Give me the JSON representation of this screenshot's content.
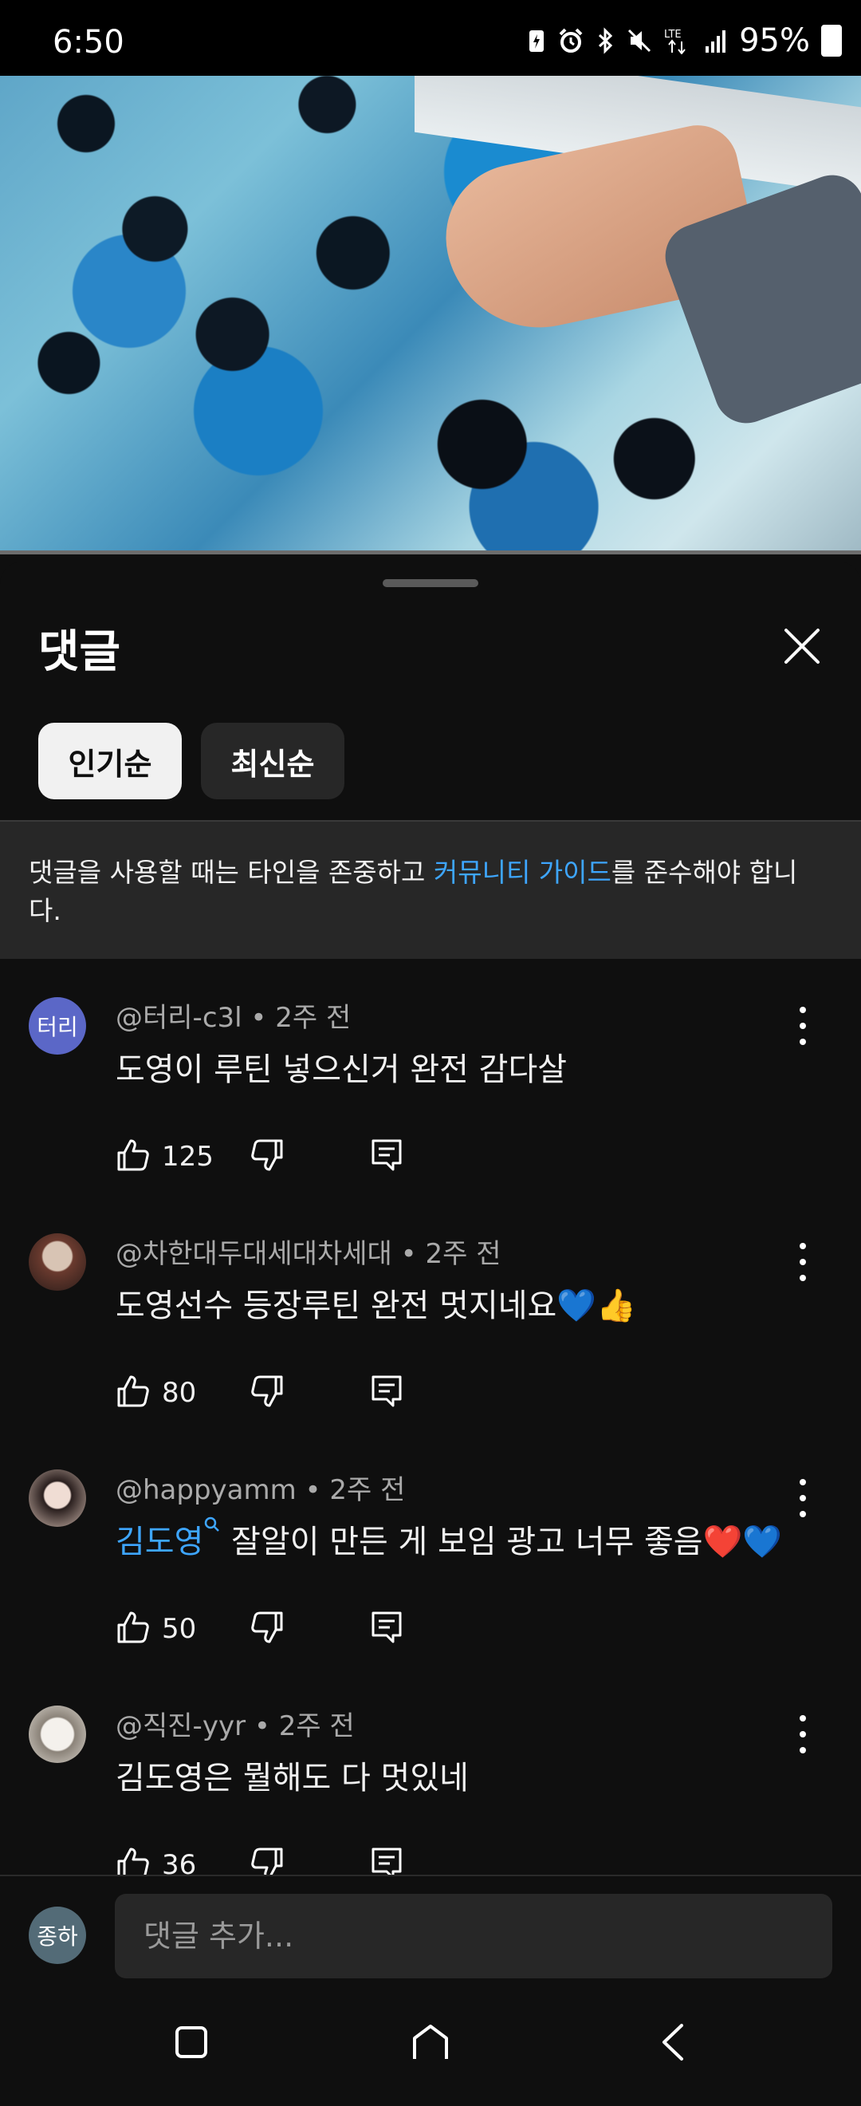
{
  "status_bar": {
    "time": "6:50",
    "battery": "95%",
    "icons": [
      "battery-saver-icon",
      "alarm-icon",
      "bluetooth-icon",
      "mute-icon",
      "lte-icon",
      "signal-icon",
      "battery-icon"
    ]
  },
  "video": {
    "description_icon": "video-thumbnail"
  },
  "sheet": {
    "title": "댓글",
    "chips": [
      {
        "label": "인기순",
        "active": true
      },
      {
        "label": "최신순",
        "active": false
      }
    ],
    "notice": {
      "prefix": "댓글을 사용할 때는 타인을 존중하고 ",
      "link": "커뮤니티 가이드",
      "suffix": "를 준수해야 합니다."
    }
  },
  "comments": [
    {
      "author": "@터리-c3l",
      "time": "2주 전",
      "avatar_text": "터리",
      "avatar_color": "#5b67c7",
      "text": "도영이 루틴 넣으신거 완전 감다살",
      "likes": "125"
    },
    {
      "author": "@차한대두대세대차세대",
      "time": "2주 전",
      "avatar_text": "",
      "avatar_color": "#7a4a3a",
      "text": "도영선수 등장루틴 완전 멋지네요💙👍",
      "likes": "80"
    },
    {
      "author": "@happyamm",
      "time": "2주 전",
      "avatar_text": "",
      "avatar_color": "#c9b3a8",
      "mention": "김도영",
      "text": " 잘알이 만든 게 보임 광고 너무 좋음❤️💙",
      "likes": "50"
    },
    {
      "author": "@직진-yyr",
      "time": "2주 전",
      "avatar_text": "",
      "avatar_color": "#d9d4cc",
      "text": "김도영은 뭘해도 다 멋있네",
      "likes": "36"
    }
  ],
  "composer": {
    "avatar_text": "종하",
    "placeholder": "댓글 추가..."
  },
  "colors": {
    "accent_link": "#3ea6ff",
    "background": "#0f0f0f",
    "surface": "#272727"
  }
}
